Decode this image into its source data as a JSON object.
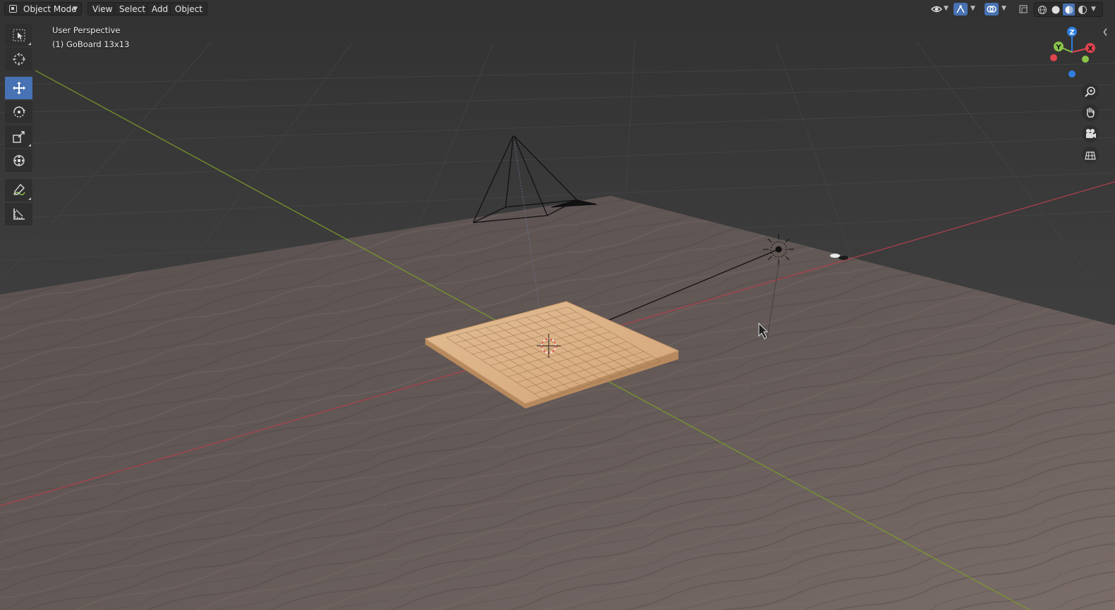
{
  "header": {
    "mode": "Object Mode",
    "menus": [
      "View",
      "Select",
      "Add",
      "Object"
    ]
  },
  "viewport": {
    "perspective_label": "User Perspective",
    "active_object_label": "(1) GoBoard 13x13"
  },
  "gizmo": {
    "axes": [
      "Z",
      "Y",
      "X"
    ]
  },
  "toolbar": {
    "active_tool": "move",
    "tools": [
      "select-box",
      "cursor",
      "move",
      "rotate",
      "scale",
      "transform",
      "annotate",
      "measure"
    ]
  },
  "navigation": [
    "zoom",
    "pan",
    "camera-view",
    "ortho-toggle"
  ],
  "shading": {
    "modes": [
      "wireframe",
      "solid",
      "material-preview",
      "rendered"
    ],
    "selected": "material-preview"
  },
  "colors": {
    "accent": "#4772b3",
    "x_axis": "#e0444f",
    "y_axis": "#8bc34a",
    "z_axis": "#2f7fe0",
    "board_wood": "#d9b38a",
    "floor": "#5e5654"
  }
}
